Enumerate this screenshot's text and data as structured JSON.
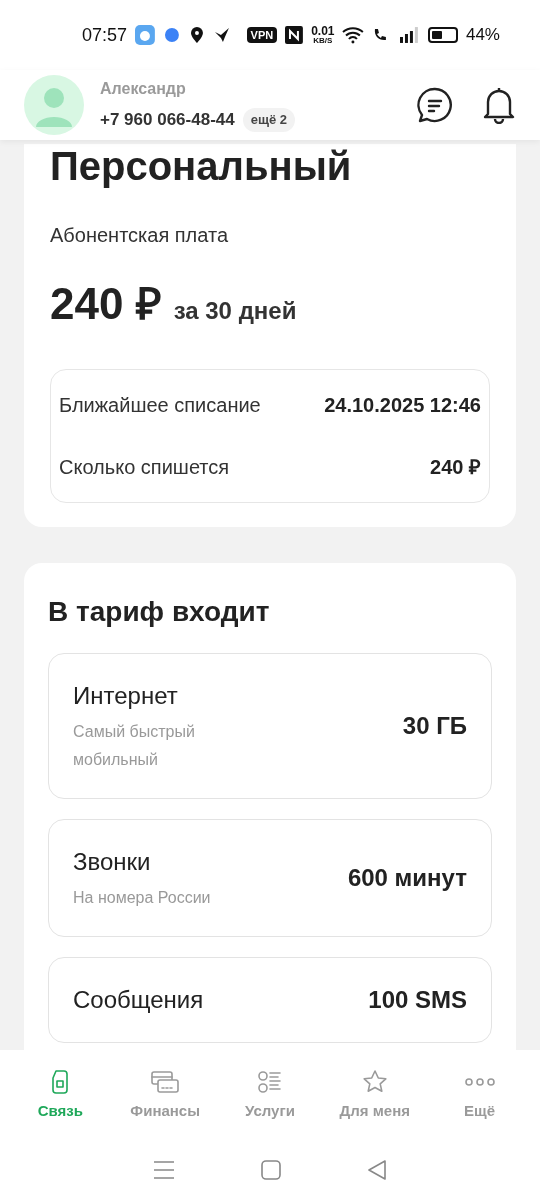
{
  "status_bar": {
    "time": "07:57",
    "vpn": "VPN",
    "speed": "0.01",
    "speed_unit": "KB/S",
    "battery": "44%"
  },
  "header": {
    "name": "Александр",
    "phone": "+7 960 066-48-44",
    "more_numbers": "ещё 2"
  },
  "tariff": {
    "title": "Персональный",
    "fee_label": "Абонентская плата",
    "price": "240 ₽",
    "period": "за 30 дней",
    "charges": [
      {
        "label": "Ближайшее списание",
        "value": "24.10.2025 12:46"
      },
      {
        "label": "Сколько спишется",
        "value": "240 ₽"
      }
    ]
  },
  "included": {
    "title": "В тариф входит",
    "items": [
      {
        "name": "Интернет",
        "note": "Самый быстрый мобильный",
        "amount": "30 ГБ"
      },
      {
        "name": "Звонки",
        "note": "На номера России",
        "amount": "600 минут"
      },
      {
        "name": "Сообщения",
        "amount": "100 SMS"
      }
    ]
  },
  "nav": [
    {
      "kind": "sim",
      "label": "Связь",
      "selected": true
    },
    {
      "kind": "cards",
      "label": "Финансы",
      "selected": false
    },
    {
      "kind": "list",
      "label": "Услуги",
      "selected": false
    },
    {
      "kind": "star",
      "label": "Для меня",
      "selected": false
    },
    {
      "kind": "dots",
      "label": "Ещё",
      "selected": false
    }
  ]
}
